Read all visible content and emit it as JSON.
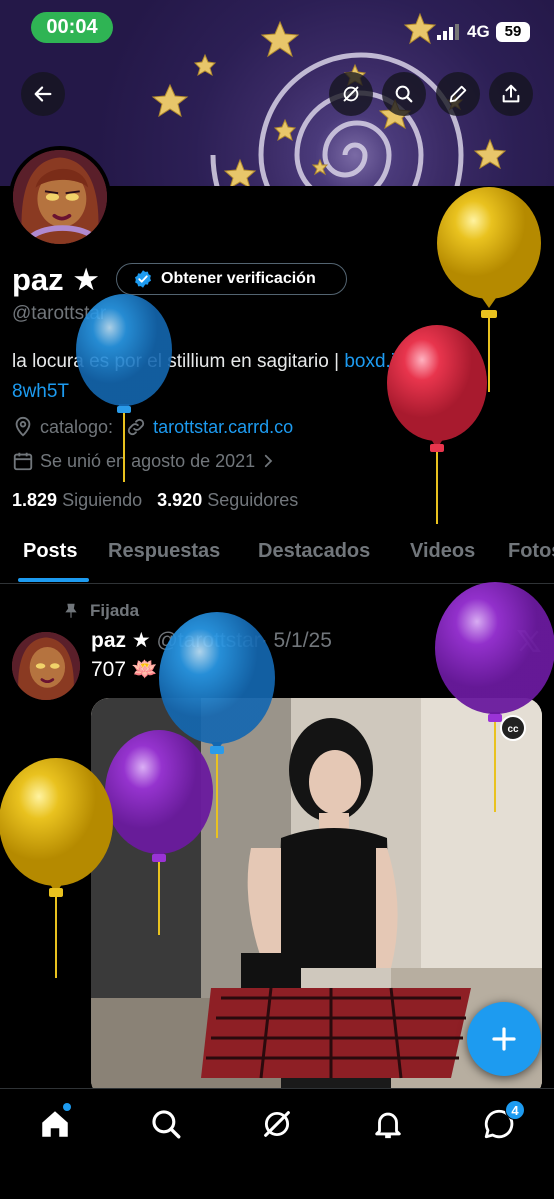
{
  "status_bar": {
    "time": "00:04",
    "network": "4G",
    "battery": "59"
  },
  "profile": {
    "name": "paz ★",
    "verify_label": "Obtener verificación",
    "handle": "@tarottstar",
    "bio_text": "la locura es por el stillium en sagitario | ",
    "bio_link_part1": "boxd.it/",
    "bio_link_part2": "8wh5T",
    "location": "catalogo:",
    "website": "tarottstar.carrd.co",
    "joined": "Se unió en agosto de 2021",
    "following_count": "1.829",
    "following_label": "Siguiendo",
    "followers_count": "3.920",
    "followers_label": "Seguidores"
  },
  "tabs": [
    "Posts",
    "Respuestas",
    "Destacados",
    "Videos",
    "Fotos"
  ],
  "post": {
    "pinned_label": "Fijada",
    "author": "paz ★",
    "handle": "@tarottstar",
    "date": "· 5/1/25",
    "text": "707 🪷",
    "cc": "cc"
  },
  "nav": {
    "messages_badge": "4"
  },
  "colors": {
    "accent": "#1d9bf0",
    "status_green": "#2fb454"
  }
}
